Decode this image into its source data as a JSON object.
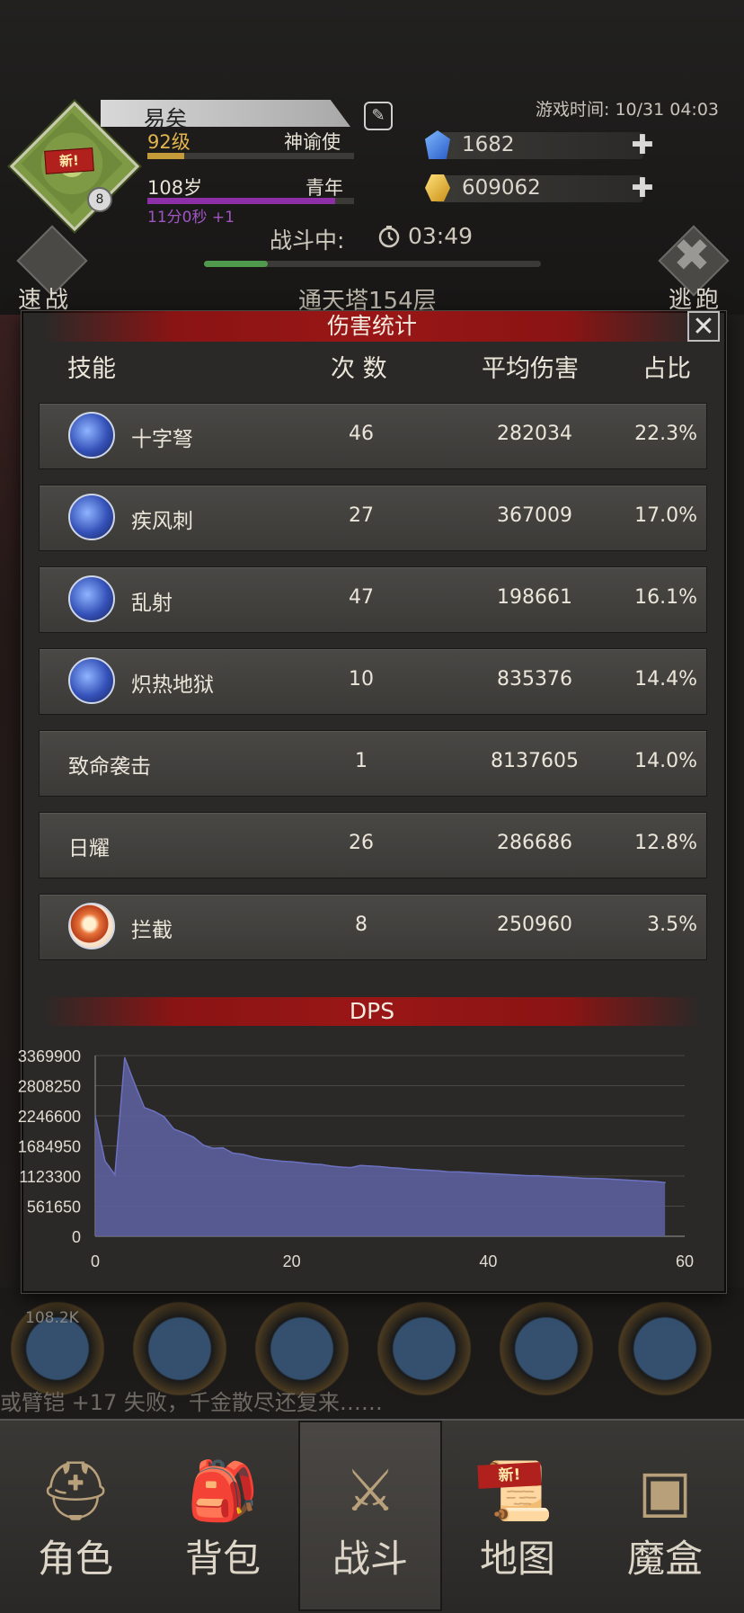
{
  "player": {
    "name": "易矣",
    "level": "92级",
    "class": "神谕使",
    "age": "108岁",
    "stage": "青年",
    "age_timer": "11分0秒 +1",
    "avatar_badge": "新!",
    "avatar_level": "8",
    "xp_progress": 0.18,
    "age_progress": 0.91
  },
  "game_time": "游戏时间: 10/31 04:03",
  "resources": {
    "gems": "1682",
    "gold": "609062",
    "plus": "✚"
  },
  "battle": {
    "status": "战斗中:",
    "timer": "03:49",
    "progress": 0.19,
    "speed_label": "速战",
    "flee_label": "逃跑",
    "location": "通天塔154层"
  },
  "damage_stats": {
    "title": "伤害统计",
    "close": "✕",
    "headers": {
      "skill": "技能",
      "count": "次 数",
      "avg": "平均伤害",
      "pct": "占比"
    },
    "rows": [
      {
        "name": "十字弩",
        "count": "46",
        "avg": "282034",
        "pct": "22.3%",
        "icon": "crossbow-bolt-icon"
      },
      {
        "name": "疾风刺",
        "count": "27",
        "avg": "367009",
        "pct": "17.0%",
        "icon": "gale-thrust-icon"
      },
      {
        "name": "乱射",
        "count": "47",
        "avg": "198661",
        "pct": "16.1%",
        "icon": "scatter-shot-icon"
      },
      {
        "name": "炽热地狱",
        "count": "10",
        "avg": "835376",
        "pct": "14.4%",
        "icon": "blazing-inferno-icon"
      },
      {
        "name": "致命袭击",
        "count": "1",
        "avg": "8137605",
        "pct": "14.0%",
        "icon": ""
      },
      {
        "name": "日耀",
        "count": "26",
        "avg": "286686",
        "pct": "12.8%",
        "icon": ""
      },
      {
        "name": "拦截",
        "count": "8",
        "avg": "250960",
        "pct": "3.5%",
        "icon": "intercept-fire-icon"
      }
    ]
  },
  "chart_data": {
    "type": "area",
    "title": "DPS",
    "xlabel": "",
    "ylabel": "",
    "xlim": [
      0,
      60
    ],
    "ylim": [
      0,
      3369900
    ],
    "x_ticks": [
      "0",
      "20",
      "40",
      "60"
    ],
    "y_ticks": [
      "3369900",
      "2808250",
      "2246600",
      "1684950",
      "1123300",
      "561650",
      "0"
    ],
    "grid": true,
    "fill_color": "#5b5f9c",
    "line_color": "#6c71c0",
    "series": [
      {
        "x": [
          0,
          1,
          2,
          3,
          4,
          5,
          6,
          7,
          8,
          9,
          10,
          11,
          12,
          13,
          14,
          15,
          16,
          17,
          18,
          19,
          20,
          21,
          22,
          23,
          24,
          25,
          26,
          27,
          28,
          29,
          30,
          31,
          32,
          33,
          34,
          35,
          36,
          37,
          38,
          39,
          40,
          41,
          42,
          43,
          44,
          45,
          46,
          47,
          48,
          49,
          50,
          51,
          52,
          53,
          54,
          55,
          56,
          57,
          58
        ],
        "y": [
          2240000,
          1400000,
          1150000,
          3330000,
          2850000,
          2400000,
          2330000,
          2230000,
          2000000,
          1930000,
          1850000,
          1700000,
          1640000,
          1650000,
          1550000,
          1530000,
          1480000,
          1440000,
          1420000,
          1400000,
          1390000,
          1370000,
          1350000,
          1340000,
          1310000,
          1290000,
          1280000,
          1320000,
          1310000,
          1300000,
          1280000,
          1270000,
          1250000,
          1240000,
          1230000,
          1220000,
          1200000,
          1200000,
          1190000,
          1180000,
          1170000,
          1160000,
          1150000,
          1140000,
          1130000,
          1130000,
          1120000,
          1110000,
          1100000,
          1090000,
          1080000,
          1080000,
          1070000,
          1060000,
          1050000,
          1040000,
          1030000,
          1020000,
          1000000
        ]
      }
    ]
  },
  "skill_bar": {
    "first_skill_value": "108.2K"
  },
  "log": "或臂铠 +17 失败，千金散尽还复来……",
  "nav": {
    "items": [
      {
        "label": "角色",
        "icon": "helmet-icon"
      },
      {
        "label": "背包",
        "icon": "backpack-icon"
      },
      {
        "label": "战斗",
        "icon": "sword-shield-icon"
      },
      {
        "label": "地图",
        "icon": "scroll-map-icon"
      },
      {
        "label": "魔盒",
        "icon": "magic-box-icon"
      }
    ],
    "active": 2,
    "map_badge": "新!"
  }
}
